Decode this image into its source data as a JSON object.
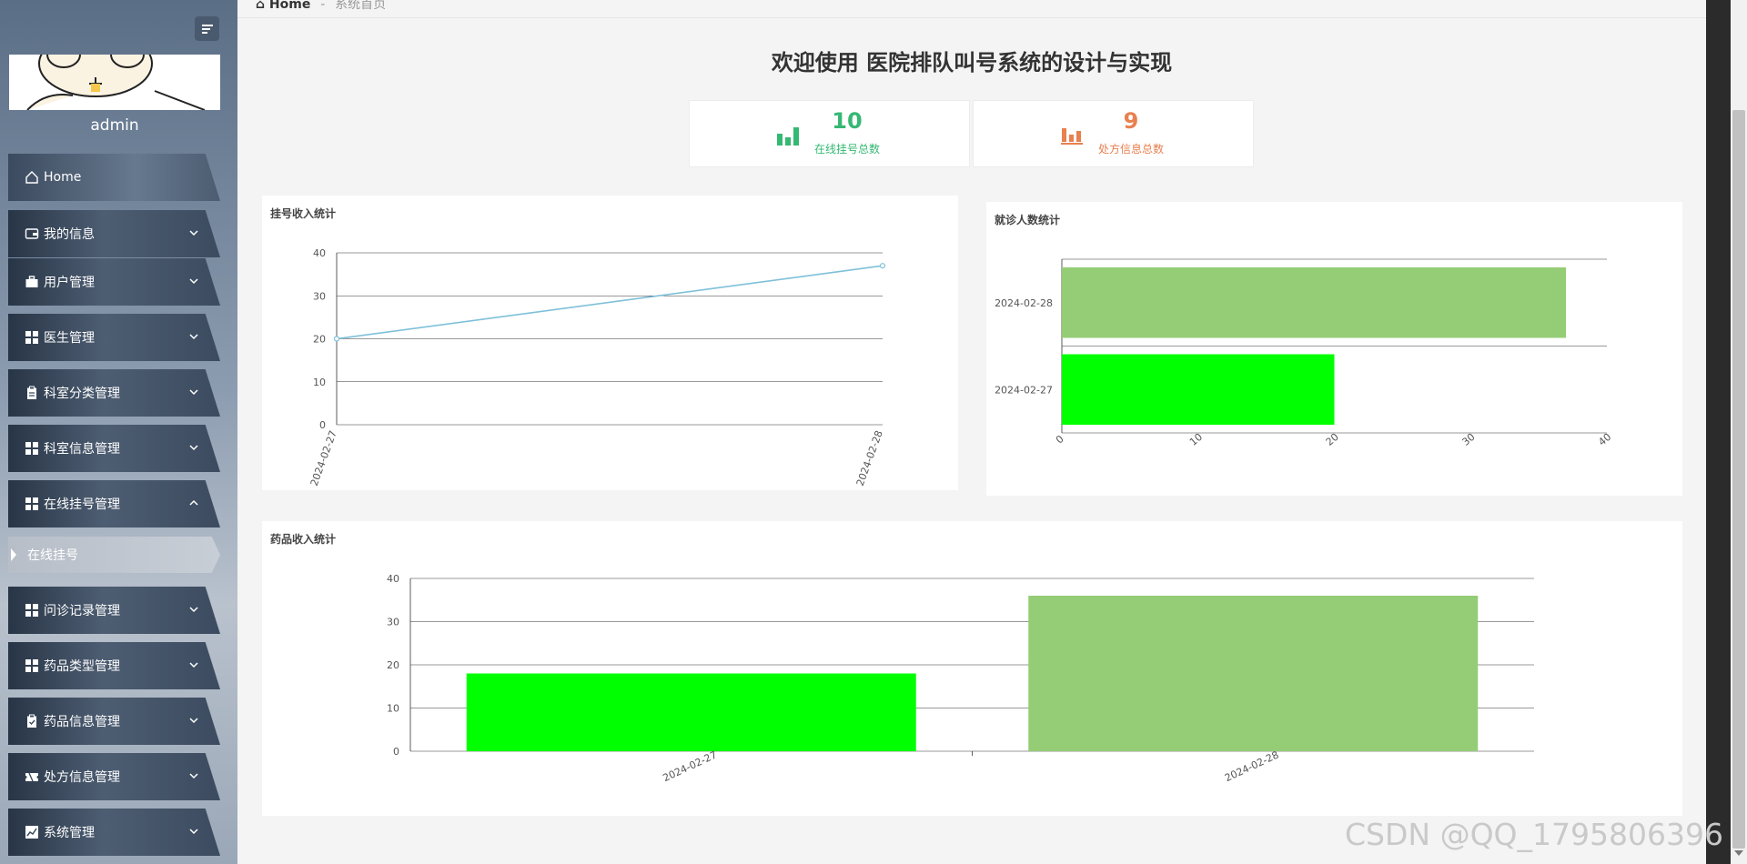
{
  "user": {
    "name": "admin"
  },
  "breadcrumb": {
    "home": "Home",
    "separator": "-",
    "current": "系统首页"
  },
  "page_title": "欢迎使用 医院排队叫号系统的设计与实现",
  "menu": {
    "home": "Home",
    "items": [
      {
        "label": "我的信息",
        "icon": "wallet-icon"
      },
      {
        "label": "用户管理",
        "icon": "briefcase-icon"
      },
      {
        "label": "医生管理",
        "icon": "grid-icon"
      },
      {
        "label": "科室分类管理",
        "icon": "clipboard-icon"
      },
      {
        "label": "科室信息管理",
        "icon": "grid-icon"
      },
      {
        "label": "在线挂号管理",
        "icon": "grid-icon"
      },
      {
        "label": "问诊记录管理",
        "icon": "grid-icon"
      },
      {
        "label": "药品类型管理",
        "icon": "grid-icon"
      },
      {
        "label": "药品信息管理",
        "icon": "clipboard-check-icon"
      },
      {
        "label": "处方信息管理",
        "icon": "ticket-icon"
      },
      {
        "label": "系统管理",
        "icon": "chart-line-icon"
      }
    ],
    "submenu": "在线挂号"
  },
  "stats": [
    {
      "value": "10",
      "label": "在线挂号总数",
      "color": "#35b873"
    },
    {
      "value": "9",
      "label": "处方信息总数",
      "color": "#e8804f"
    }
  ],
  "watermark": "CSDN @QQ_1795806396",
  "chart_data": [
    {
      "type": "line",
      "title": "挂号收入统计",
      "x": [
        "2024-02-27",
        "2024-02-28"
      ],
      "series": [
        {
          "values": [
            20,
            37
          ],
          "color": "#7ec0d9"
        }
      ],
      "ylim": [
        0,
        40
      ],
      "yticks": [
        0,
        10,
        20,
        30,
        40
      ],
      "grid": true
    },
    {
      "type": "bar",
      "orientation": "horizontal",
      "title": "就诊人数统计",
      "categories": [
        "2024-02-28",
        "2024-02-27"
      ],
      "values": [
        37,
        20
      ],
      "colors": [
        "#94cd76",
        "#00ff00"
      ],
      "xlim": [
        0,
        40
      ],
      "xticks": [
        0,
        10,
        20,
        30,
        40
      ]
    },
    {
      "type": "bar",
      "title": "药品收入统计",
      "categories": [
        "2024-02-27",
        "2024-02-28"
      ],
      "values": [
        18,
        36
      ],
      "colors": [
        "#00ff00",
        "#94cd76"
      ],
      "ylim": [
        0,
        40
      ],
      "yticks": [
        0,
        10,
        20,
        30,
        40
      ],
      "grid": true
    }
  ]
}
